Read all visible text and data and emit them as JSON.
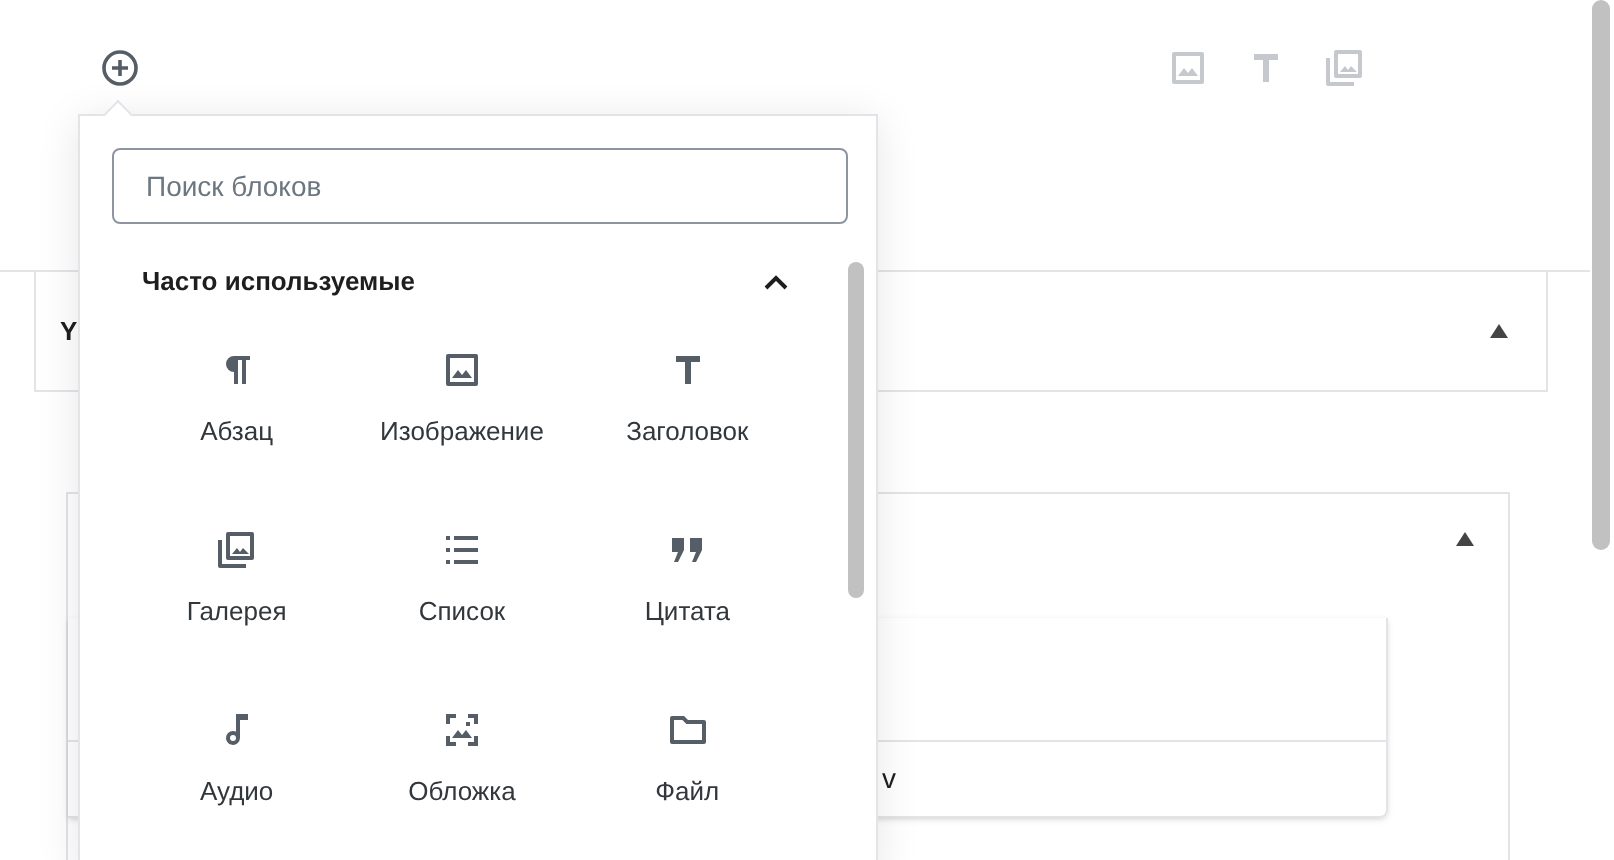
{
  "inserter": {
    "search": {
      "placeholder": "Поиск блоков"
    },
    "section": {
      "title": "Часто используемые",
      "expanded": true
    },
    "blocks": [
      {
        "label": "Абзац"
      },
      {
        "label": "Изображение"
      },
      {
        "label": "Заголовок"
      },
      {
        "label": "Галерея"
      },
      {
        "label": "Список"
      },
      {
        "label": "Цитата"
      },
      {
        "label": "Аудио"
      },
      {
        "label": "Обложка"
      },
      {
        "label": "Файл"
      }
    ]
  },
  "background": {
    "panel_1": {
      "text": "Y",
      "expanded": true
    },
    "panel_2": {
      "expanded": true,
      "card_text": "v"
    }
  }
}
